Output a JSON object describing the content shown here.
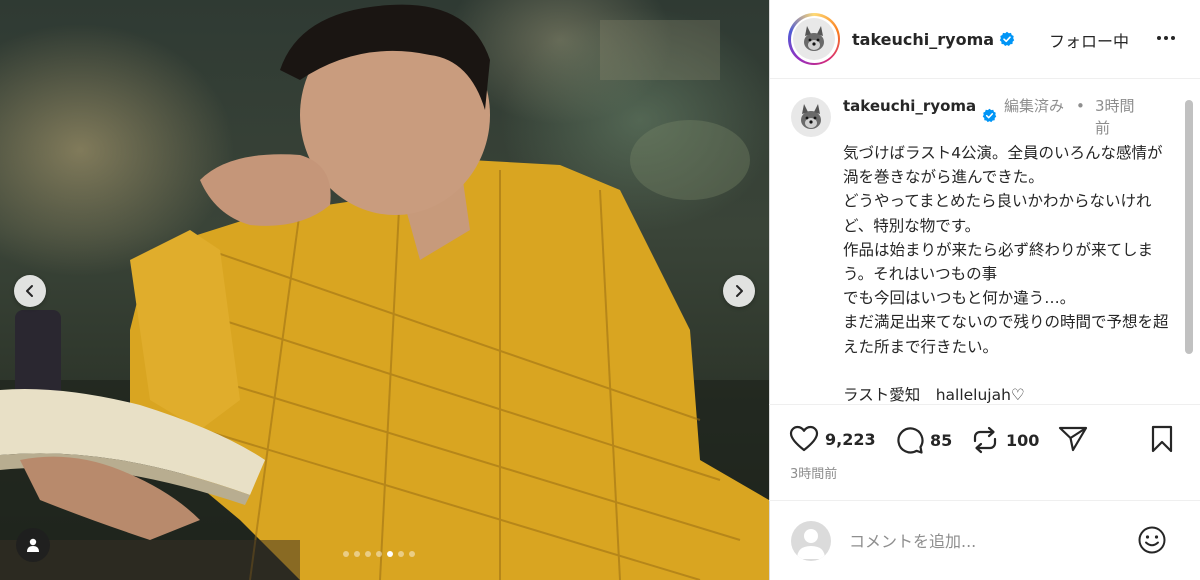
{
  "post": {
    "username": "takeuchi_ryoma",
    "verified": true,
    "follow_label": "フォロー中",
    "more_icon": "more-horizontal-icon"
  },
  "caption": {
    "username": "takeuchi_ryoma",
    "edited_label": "編集済み",
    "separator": "•",
    "time": "3時間前",
    "text": "気づけばラスト4公演。全員のいろんな感情が渦を巻きながら進んできた。\nどうやってまとめたら良いかわからないけれど、特別な物です。\n作品は始まりが来たら必ず終わりが来てしまう。それはいつもの事\nでも今回はいつもと何か違う…。\nまだ満足出来てないので残りの時間で予想を超えた所まで行きたい。\n\nラスト愛知　hallelujah♡"
  },
  "actions": {
    "likes": "9,223",
    "comments": "85",
    "reposts": "100",
    "timestamp": "3時間前"
  },
  "carousel": {
    "total_slides": 7,
    "active_index": 4
  },
  "comment_box": {
    "placeholder": "コメントを追加..."
  },
  "colors": {
    "verified_blue": "#0095f6",
    "text_primary": "#262626",
    "text_secondary": "#8e8e8e",
    "shirt_yellow": "#d9a521"
  }
}
